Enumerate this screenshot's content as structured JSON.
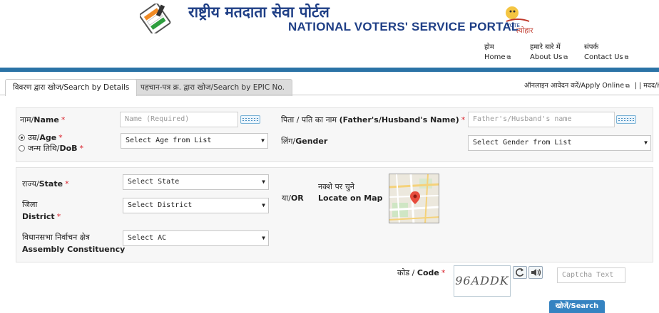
{
  "header": {
    "title_hindi": "राष्ट्रीय मतदाता सेवा पोर्टल",
    "title_english": "NATIONAL VOTERS' SERVICE PORTAL",
    "nav": [
      {
        "hindi": "होम",
        "english": "Home"
      },
      {
        "hindi": "हमारे बारे में",
        "english": "About Us"
      },
      {
        "hindi": "संपर्क",
        "english": "Contact Us"
      }
    ]
  },
  "tabs": [
    {
      "label": "विवरण द्वारा खोज/Search by Details",
      "active": true
    },
    {
      "label": "पहचान-पत्र क्र. द्वारा खोज/Search by EPIC No.",
      "active": false
    }
  ],
  "apply_link": "ऑनलाइन आवेदन करें/Apply Online",
  "apply_tail": "|  |  मदद/He",
  "form": {
    "name_label_hi": "नाम/",
    "name_label_en": "Name",
    "name_placeholder": "Name (Required)",
    "father_label_hi": "पिता / पति का नाम ",
    "father_label_en": "(Father's/Husband's Name)",
    "father_placeholder": "Father's/Husband's name",
    "age_label_hi": "उम्र/",
    "age_label_en": "Age",
    "dob_label_hi": "जन्म तिथि/",
    "dob_label_en": "DoB",
    "age_select": "Select Age from List",
    "gender_label_hi": "लिंग/",
    "gender_label_en": "Gender",
    "gender_select": "Select Gender from List",
    "state_label_hi": "राज्य/",
    "state_label_en": "State",
    "state_select": "Select State",
    "district_label_hi": "जिला",
    "district_label_en": "District",
    "district_select": "Select District",
    "ac_label_hi": "विधानसभा निर्वाचन क्षेत्र",
    "ac_label_en": "Assembly Constituency",
    "ac_select": "Select AC",
    "or_hi": "या/",
    "or_en": "OR",
    "map_label_hi": "नक्शे पर चुने",
    "map_label_en": "Locate on Map",
    "code_label": "कोड / ",
    "code_label_en": "Code",
    "captcha_text": "96ADDK",
    "captcha_placeholder": "Captcha Text",
    "search_button": "खोजें/Search",
    "required_mark": "*"
  },
  "colors": {
    "title_blue": "#1f3f86",
    "band_blue": "#2b73a6",
    "required_red": "#d9232d",
    "button_blue": "#3583c1"
  }
}
